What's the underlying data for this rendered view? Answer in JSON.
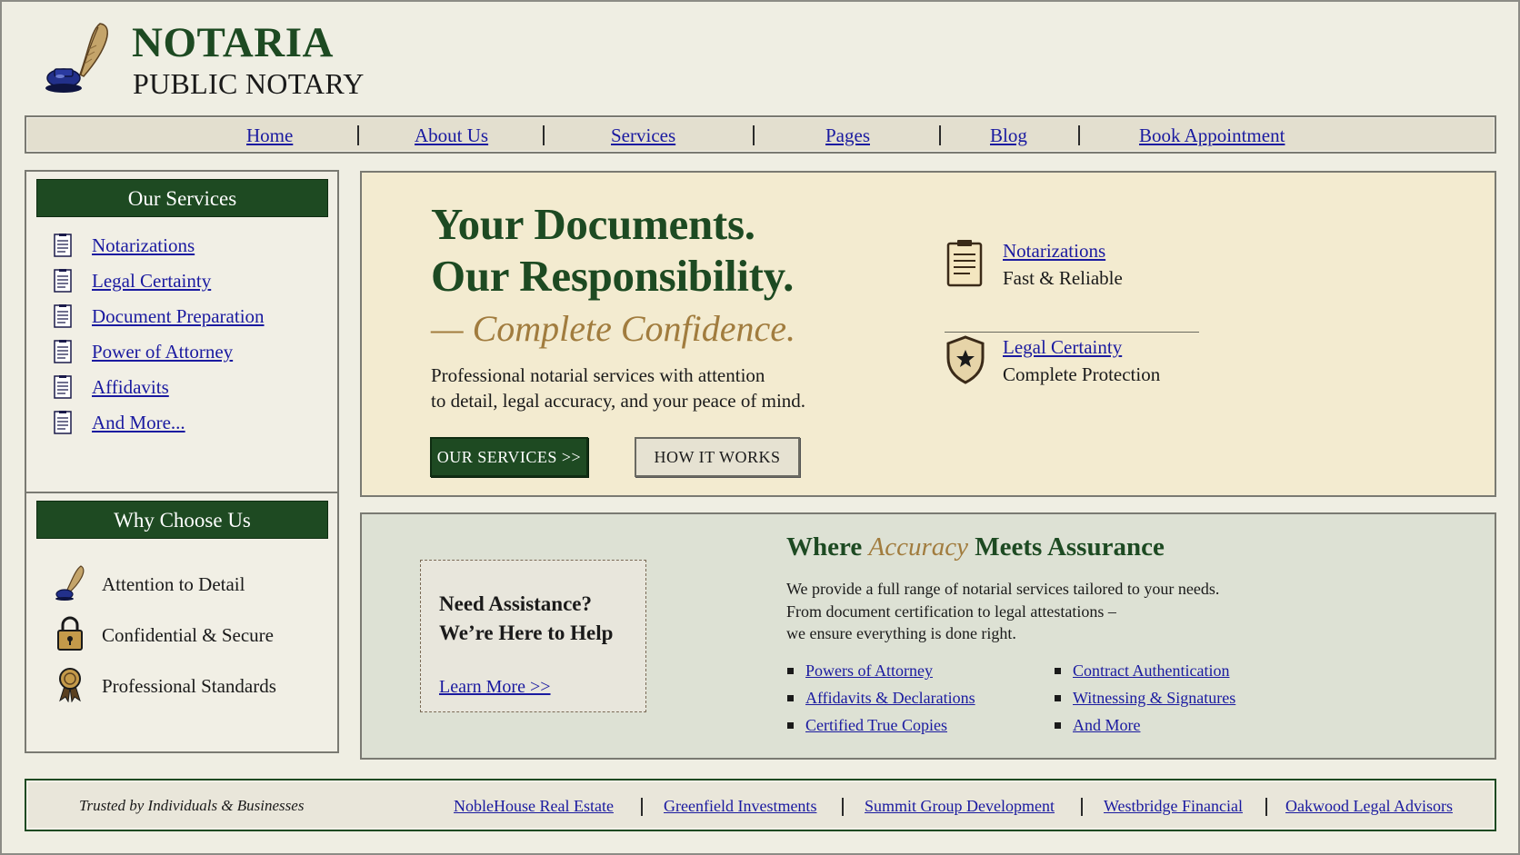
{
  "brand": {
    "name": "NOTARIA",
    "subtitle": "PUBLIC NOTARY"
  },
  "nav": {
    "items": [
      "Home",
      "About Us",
      "Services",
      "Pages",
      "Blog",
      "Book Appointment"
    ]
  },
  "sidebar": {
    "services_title": "Our Services",
    "services": [
      "Notarizations",
      "Legal Certainty",
      "Document Preparation",
      "Power of Attorney",
      "Affidavits",
      "And More..."
    ],
    "why_title": "Why Choose Us",
    "why": [
      {
        "label": "Attention to Detail",
        "icon": "quill-icon"
      },
      {
        "label": "Confidential & Secure",
        "icon": "padlock-icon"
      },
      {
        "label": "Professional Standards",
        "icon": "ribbon-icon"
      }
    ]
  },
  "hero": {
    "line1": "Your Documents.",
    "line2": "Our Responsibility.",
    "tagline": "— Complete Confidence.",
    "desc1": "Professional notarial services with attention",
    "desc2": "to detail, legal accuracy, and your peace of mind.",
    "btn_services": "OUR SERVICES >>",
    "btn_how": "HOW IT WORKS",
    "features": [
      {
        "title": "Notarizations",
        "subtitle": "Fast & Reliable",
        "icon": "document-icon"
      },
      {
        "title": "Legal Certainty",
        "subtitle": "Complete Protection",
        "icon": "shield-icon"
      }
    ]
  },
  "assist": {
    "line1": "Need Assistance?",
    "line2": "We’re Here to Help",
    "link": "Learn More >>"
  },
  "accuracy": {
    "title_pre": "Where ",
    "title_em": "Accuracy",
    "title_post": " Meets Assurance",
    "desc1": "We provide a full range of notarial services tailored to your needs.",
    "desc2": "From document certification to legal attestations –",
    "desc3": "we ensure everything is done right.",
    "links_left": [
      "Powers of Attorney",
      "Affidavits & Declarations",
      "Certified True Copies"
    ],
    "links_right": [
      "Contract Authentication",
      "Witnessing & Signatures",
      "And More"
    ]
  },
  "footer": {
    "trusted": "Trusted by Individuals & Businesses",
    "partners": [
      "NobleHouse Real Estate",
      "Greenfield Investments",
      "Summit Group Development",
      "Westbridge Financial",
      "Oakwood Legal Advisors"
    ]
  },
  "colors": {
    "brand_green": "#1e4a22",
    "gold": "#a17c3e",
    "link": "#1a1aa0",
    "hero_bg": "#f3ebd0",
    "lower_bg": "#dde1d4"
  }
}
